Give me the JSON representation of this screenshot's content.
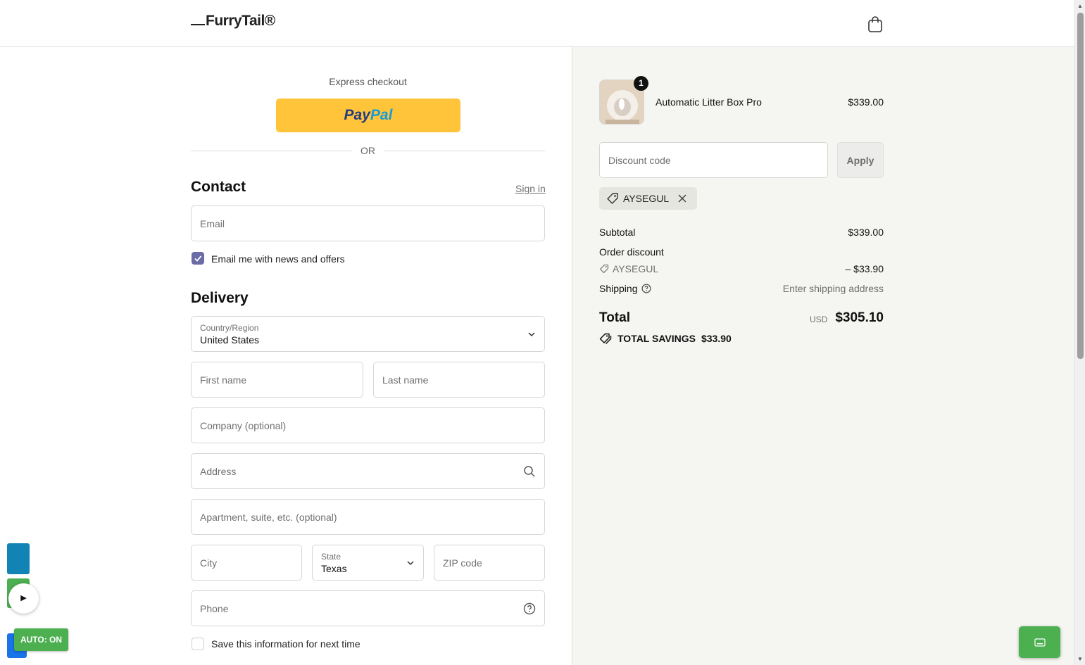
{
  "header": {
    "logo": "FurryTail®",
    "cart_icon": "shopping-bag-icon"
  },
  "express": {
    "title": "Express checkout",
    "paypal_pay": "Pay",
    "paypal_pal": "Pal",
    "or": "OR"
  },
  "contact": {
    "title": "Contact",
    "sign_in": "Sign in",
    "email_placeholder": "Email",
    "news_checkbox_label": "Email me with news and offers",
    "news_checked": true
  },
  "delivery": {
    "title": "Delivery",
    "country_label": "Country/Region",
    "country_value": "United States",
    "first_name_placeholder": "First name",
    "last_name_placeholder": "Last name",
    "company_placeholder": "Company (optional)",
    "address_placeholder": "Address",
    "apartment_placeholder": "Apartment, suite, etc. (optional)",
    "city_placeholder": "City",
    "state_label": "State",
    "state_value": "Texas",
    "zip_placeholder": "ZIP code",
    "phone_placeholder": "Phone",
    "save_info_label": "Save this information for next time",
    "save_info_checked": false
  },
  "order": {
    "product": {
      "name": "Automatic Litter Box Pro",
      "price": "$339.00",
      "quantity": "1"
    },
    "discount_placeholder": "Discount code",
    "apply_label": "Apply",
    "applied_code": "AYSEGUL",
    "subtotal_label": "Subtotal",
    "subtotal_value": "$339.00",
    "order_discount_label": "Order discount",
    "discount_code": "AYSEGUL",
    "discount_value": "– $33.90",
    "shipping_label": "Shipping",
    "shipping_value": "Enter shipping address",
    "total_label": "Total",
    "total_currency": "USD",
    "total_value": "$305.10",
    "savings_label": "TOTAL SAVINGS",
    "savings_value": "$33.90"
  },
  "extension": {
    "play": "▶",
    "auto": "AUTO: ON"
  },
  "colors": {
    "paypal": "#ffc439",
    "checkbox_accent": "#6b6ba8",
    "summary_bg": "#f5f5f1",
    "extension_green": "#4caf50"
  }
}
